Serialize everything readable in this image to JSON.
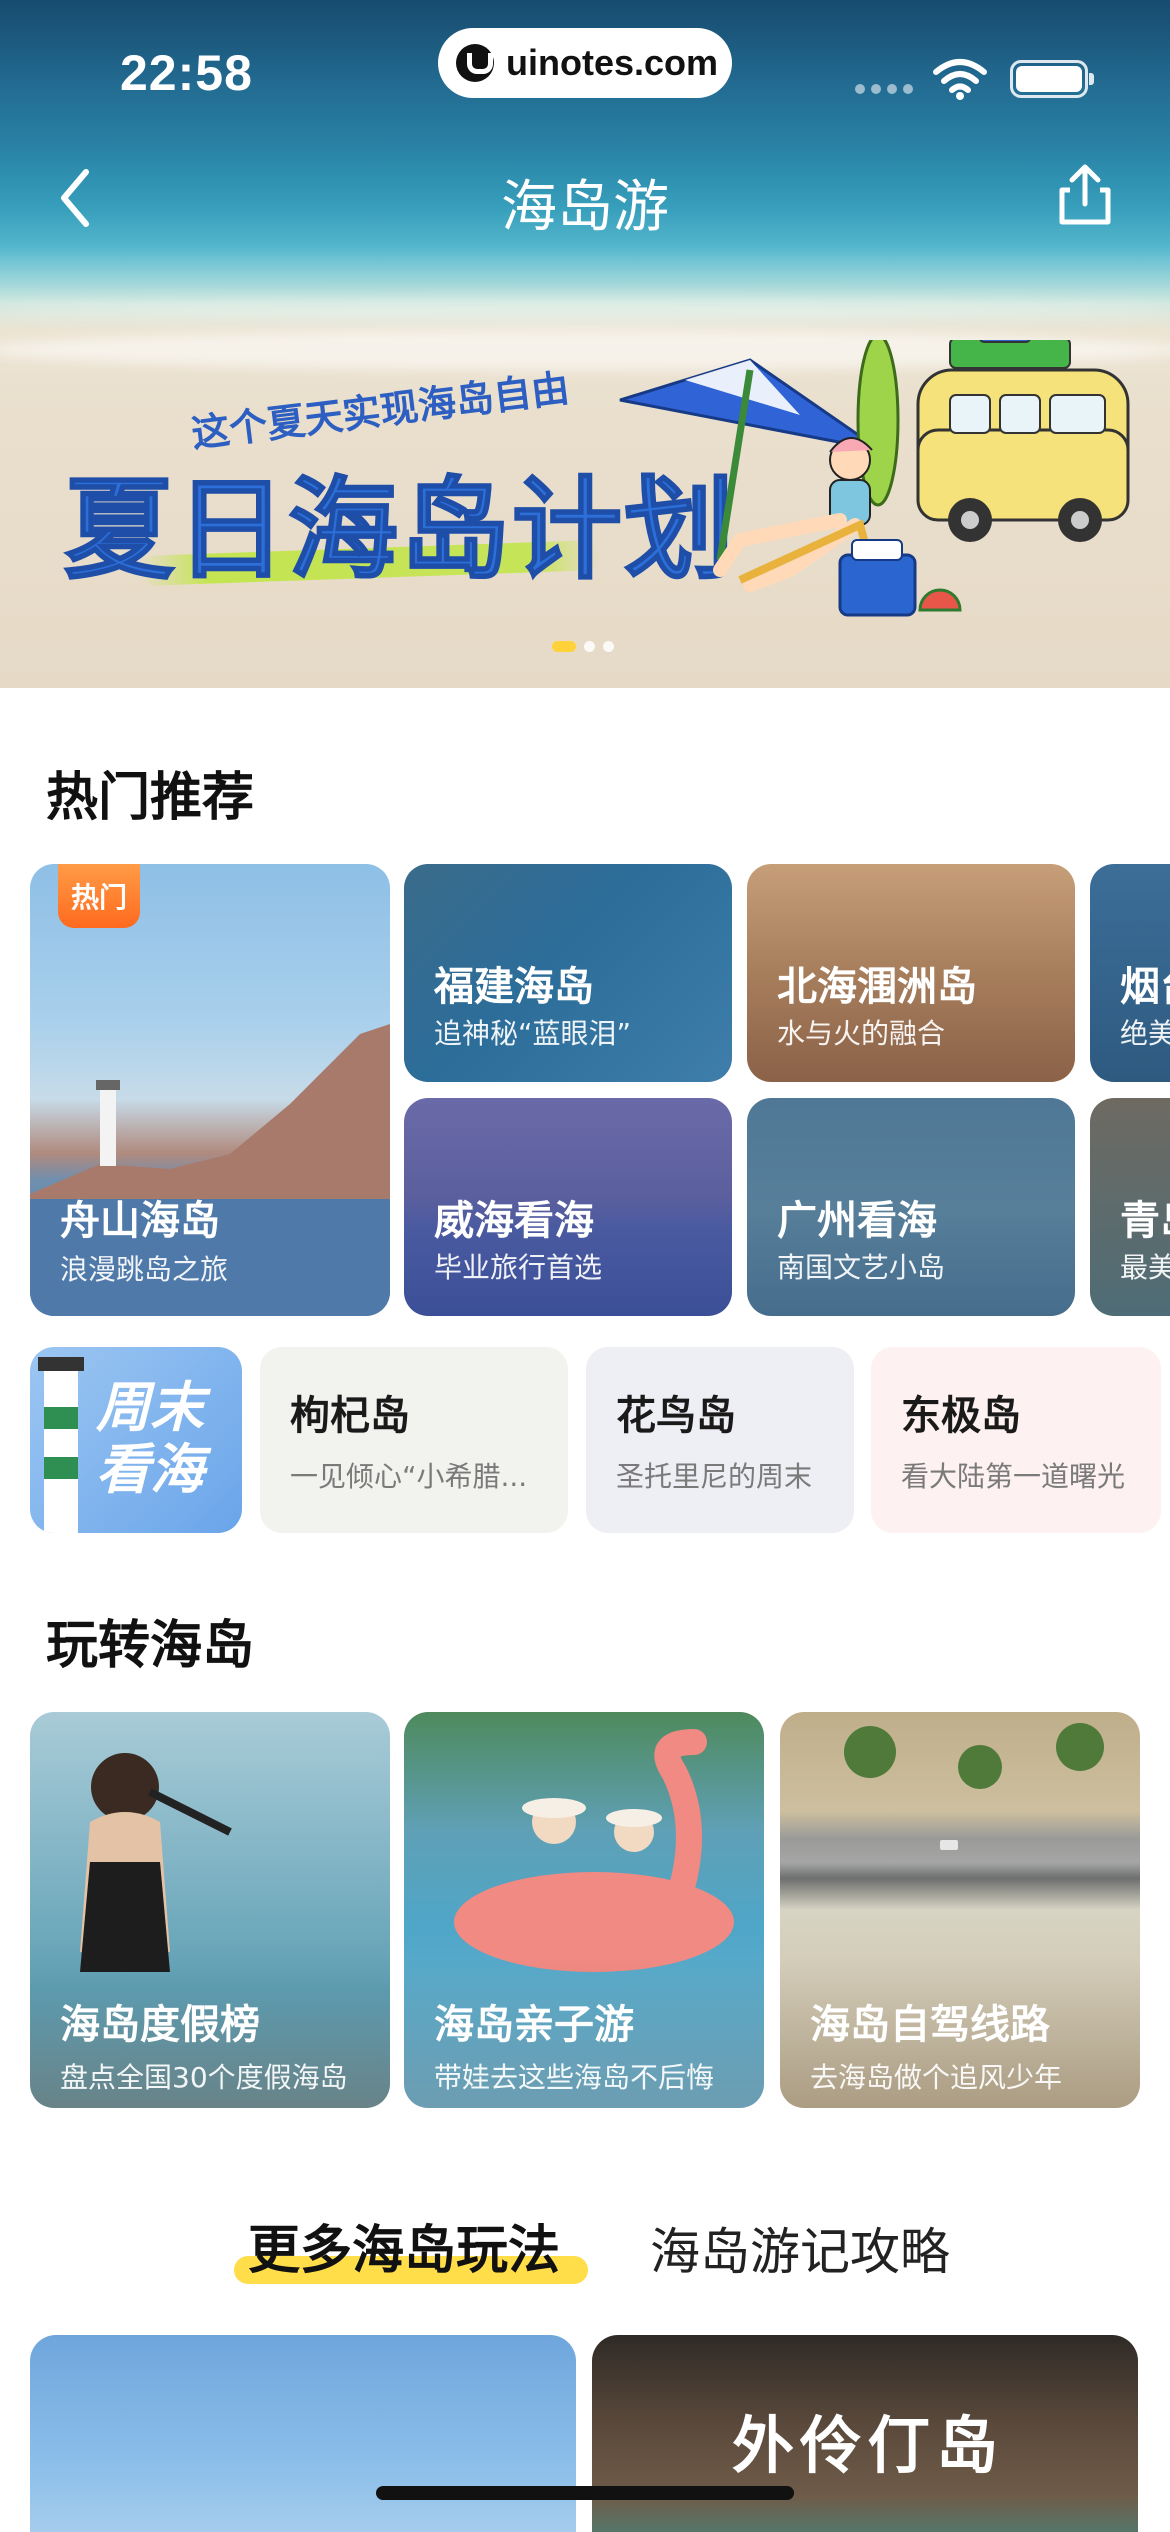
{
  "status": {
    "time": "22:58",
    "url_pill": "uinotes.com"
  },
  "nav": {
    "title": "海岛游"
  },
  "banner": {
    "subtitle": "这个夏天实现海岛自由",
    "title": "夏日海岛计划",
    "slides": 3,
    "active_slide": 1
  },
  "hot": {
    "title": "热门推荐",
    "badge": "热门",
    "featured": {
      "title": "舟山海岛",
      "subtitle": "浪漫跳岛之旅"
    },
    "cards": [
      {
        "title": "福建海岛",
        "subtitle": "追神秘“蓝眼泪”"
      },
      {
        "title": "北海涠洲岛",
        "subtitle": "水与火的融合"
      },
      {
        "title": "烟台",
        "subtitle": "绝美"
      },
      {
        "title": "威海看海",
        "subtitle": "毕业旅行首选"
      },
      {
        "title": "广州看海",
        "subtitle": "南国文艺小岛"
      },
      {
        "title": "青岛",
        "subtitle": "最美"
      }
    ]
  },
  "weekend": {
    "label_line1": "周末",
    "label_line2": "看海",
    "items": [
      {
        "title": "枸杞岛",
        "subtitle": "一见倾心“小希腊..."
      },
      {
        "title": "花鸟岛",
        "subtitle": "圣托里尼的周末"
      },
      {
        "title": "东极岛",
        "subtitle": "看大陆第一道曙光"
      }
    ]
  },
  "play": {
    "title": "玩转海岛",
    "cards": [
      {
        "title": "海岛度假榜",
        "subtitle": "盘点全国30个度假海岛"
      },
      {
        "title": "海岛亲子游",
        "subtitle": "带娃去这些海岛不后悔"
      },
      {
        "title": "海岛自驾线路",
        "subtitle": "去海岛做个追风少年"
      }
    ]
  },
  "tabs": {
    "active": "更多海岛玩法",
    "inactive": "海岛游记攻略"
  },
  "feed": {
    "card2_title": "外伶仃岛"
  },
  "colors": {
    "accent_yellow": "#ffde4a",
    "badge_orange": "#ff7a28",
    "banner_blue": "#2c6fd8"
  }
}
